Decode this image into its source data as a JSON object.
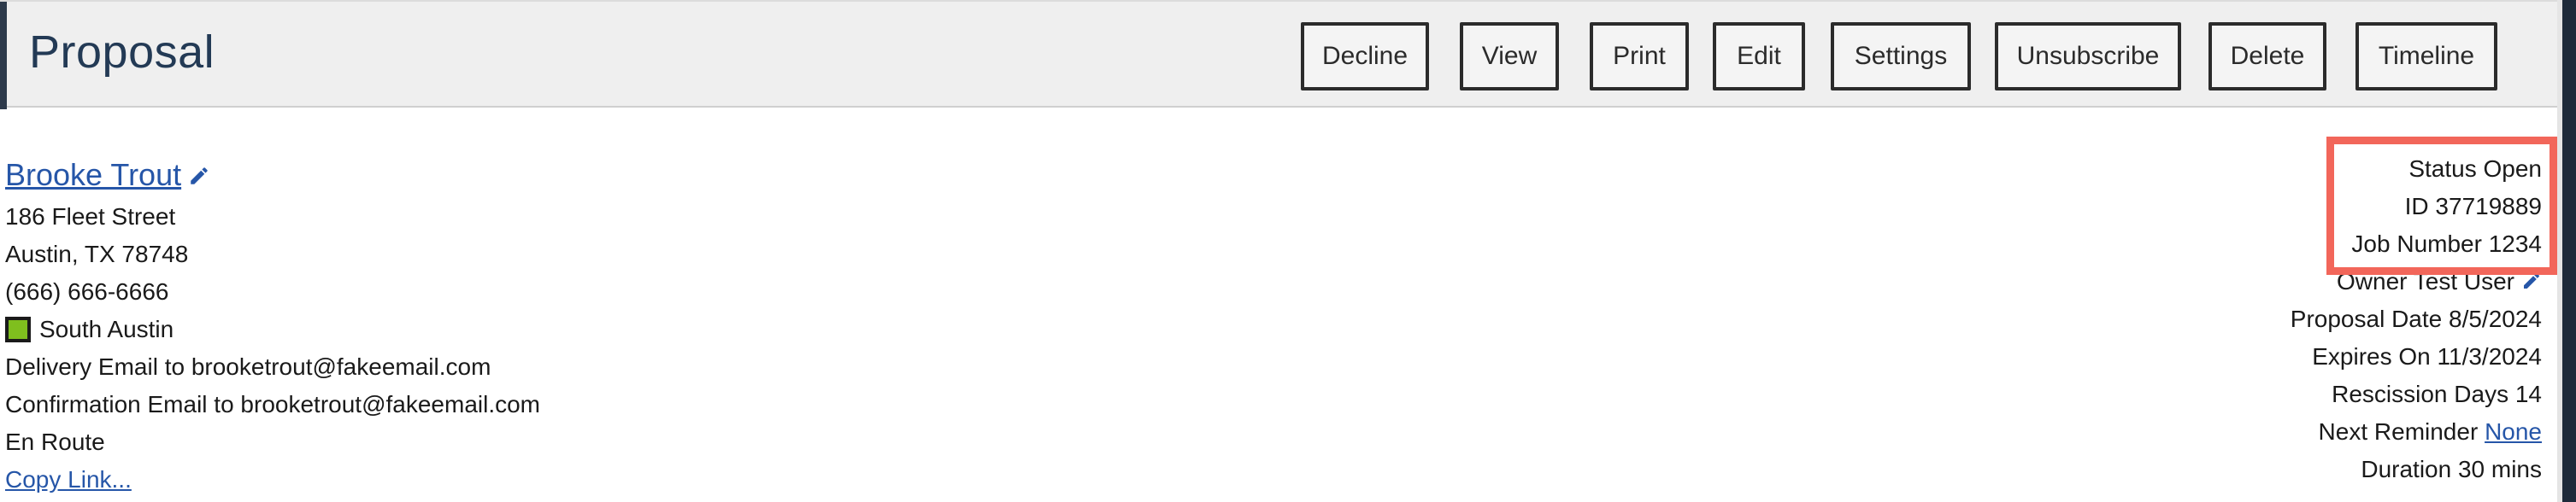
{
  "header": {
    "title": "Proposal",
    "buttons": [
      "Decline",
      "View",
      "Print",
      "Edit",
      "Settings",
      "Unsubscribe",
      "Delete",
      "Timeline"
    ]
  },
  "contact": {
    "name": "Brooke Trout",
    "address_line1": "186 Fleet Street",
    "address_line2": "Austin, TX 78748",
    "phone": "(666) 666-6666",
    "territory": "South Austin",
    "territory_color": "#7fbf1e",
    "delivery_email": "Delivery Email to brooketrout@fakeemail.com",
    "confirmation_email": "Confirmation Email to brooketrout@fakeemail.com",
    "status_note": "En Route",
    "copy_link": "Copy Link..."
  },
  "meta": {
    "status": "Status Open",
    "id": "ID 37719889",
    "job_number": "Job Number 1234",
    "owner": "Owner Test User",
    "proposal_date": "Proposal Date 8/5/2024",
    "expires_on": "Expires On 11/3/2024",
    "rescission_days": "Rescission Days 14",
    "next_reminder_label": "Next Reminder",
    "next_reminder_value": "None",
    "duration": "Duration 30 mins"
  },
  "colors": {
    "highlight": "#f2665a",
    "link": "#2656a8",
    "title": "#233a55"
  }
}
